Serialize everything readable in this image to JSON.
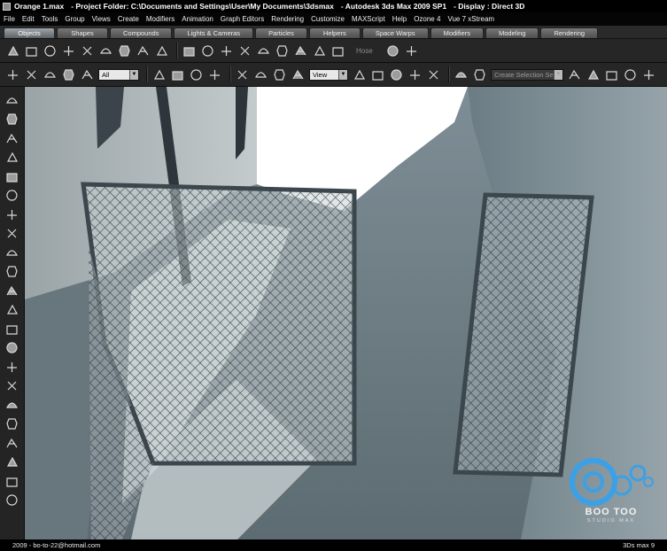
{
  "title_bar": {
    "file": "Orange 1.max",
    "project": "- Project Folder: C:\\Documents and Settings\\User\\My Documents\\3dsmax",
    "app": "- Autodesk 3ds Max  2009 SP1",
    "display": "- Display : Direct 3D"
  },
  "menu": [
    "File",
    "Edit",
    "Tools",
    "Group",
    "Views",
    "Create",
    "Modifiers",
    "Animation",
    "Graph Editors",
    "Rendering",
    "Customize",
    "MAXScript",
    "Help",
    "Ozone 4",
    "Vue 7 xStream"
  ],
  "tabs": [
    "Objects",
    "Shapes",
    "Compounds",
    "Lights & Cameras",
    "Particles",
    "Helpers",
    "Space Warps",
    "Modifiers",
    "Modeling",
    "Rendering"
  ],
  "active_tab": "Objects",
  "toolbar": {
    "hose_label": "Hose",
    "selection_filter": "All",
    "reference_coord": "View",
    "named_selection_placeholder": "Create Selection Se"
  },
  "icons": {
    "row1": [
      "box-icon",
      "cone-icon",
      "cylinder-icon",
      "sphere-icon",
      "teapot-icon",
      "pyramid-icon",
      "geosphere-icon",
      "torus-icon",
      "plane-icon",
      "star-icon",
      "gem-icon",
      "chamfer-box-icon",
      "capsule-icon",
      "gear-icon",
      "spindle-icon",
      "oil-tank-icon",
      "hedra-icon",
      "cloth-icon",
      "shape-icon",
      "plant-icon"
    ],
    "row2": [
      "undo-icon",
      "redo-icon",
      "link-icon",
      "unlink-icon",
      "bind-space-warp-icon",
      "select-arrow-icon",
      "select-by-name-icon",
      "rect-region-icon",
      "window-crossing-icon",
      "move-icon",
      "rotate-icon",
      "scale-icon",
      "pivot-icon",
      "manipulate-icon",
      "snap-icon",
      "angle-snap-icon",
      "percent-snap-icon",
      "spinner-snap-icon",
      "mirror-icon",
      "align-icon",
      "layers-icon",
      "curve-editor-icon",
      "schematic-icon",
      "material-editor-icon",
      "render-setup-icon"
    ],
    "left": [
      "box-tool-icon",
      "stack-icon",
      "torus-tool-icon",
      "boat-icon",
      "shape-tool-icon",
      "disk-icon",
      "brush-icon",
      "tag-icon",
      "gear-tool-icon",
      "dots-icon",
      "wing-icon",
      "hand-icon",
      "wave-icon",
      "ring-icon",
      "mallet-icon",
      "bolt-icon",
      "camera-icon",
      "dish-icon",
      "knot-icon",
      "arrow-icon",
      "tower-icon",
      "swirl-icon"
    ]
  },
  "logo": {
    "brand": "BOO TOO",
    "tagline": "STUDIO MAX",
    "color": "#3ba0e6"
  },
  "status": {
    "left": "2009  -  bo-to-22@hotmail.com",
    "right": "3Ds max 9"
  },
  "colors": {
    "title_bg": "#000000",
    "toolbar_bg": "#262626",
    "tab_active": "#9ea4a8",
    "viewport_sky": "#ffffff",
    "wall_shadow": "#4f5c63"
  }
}
